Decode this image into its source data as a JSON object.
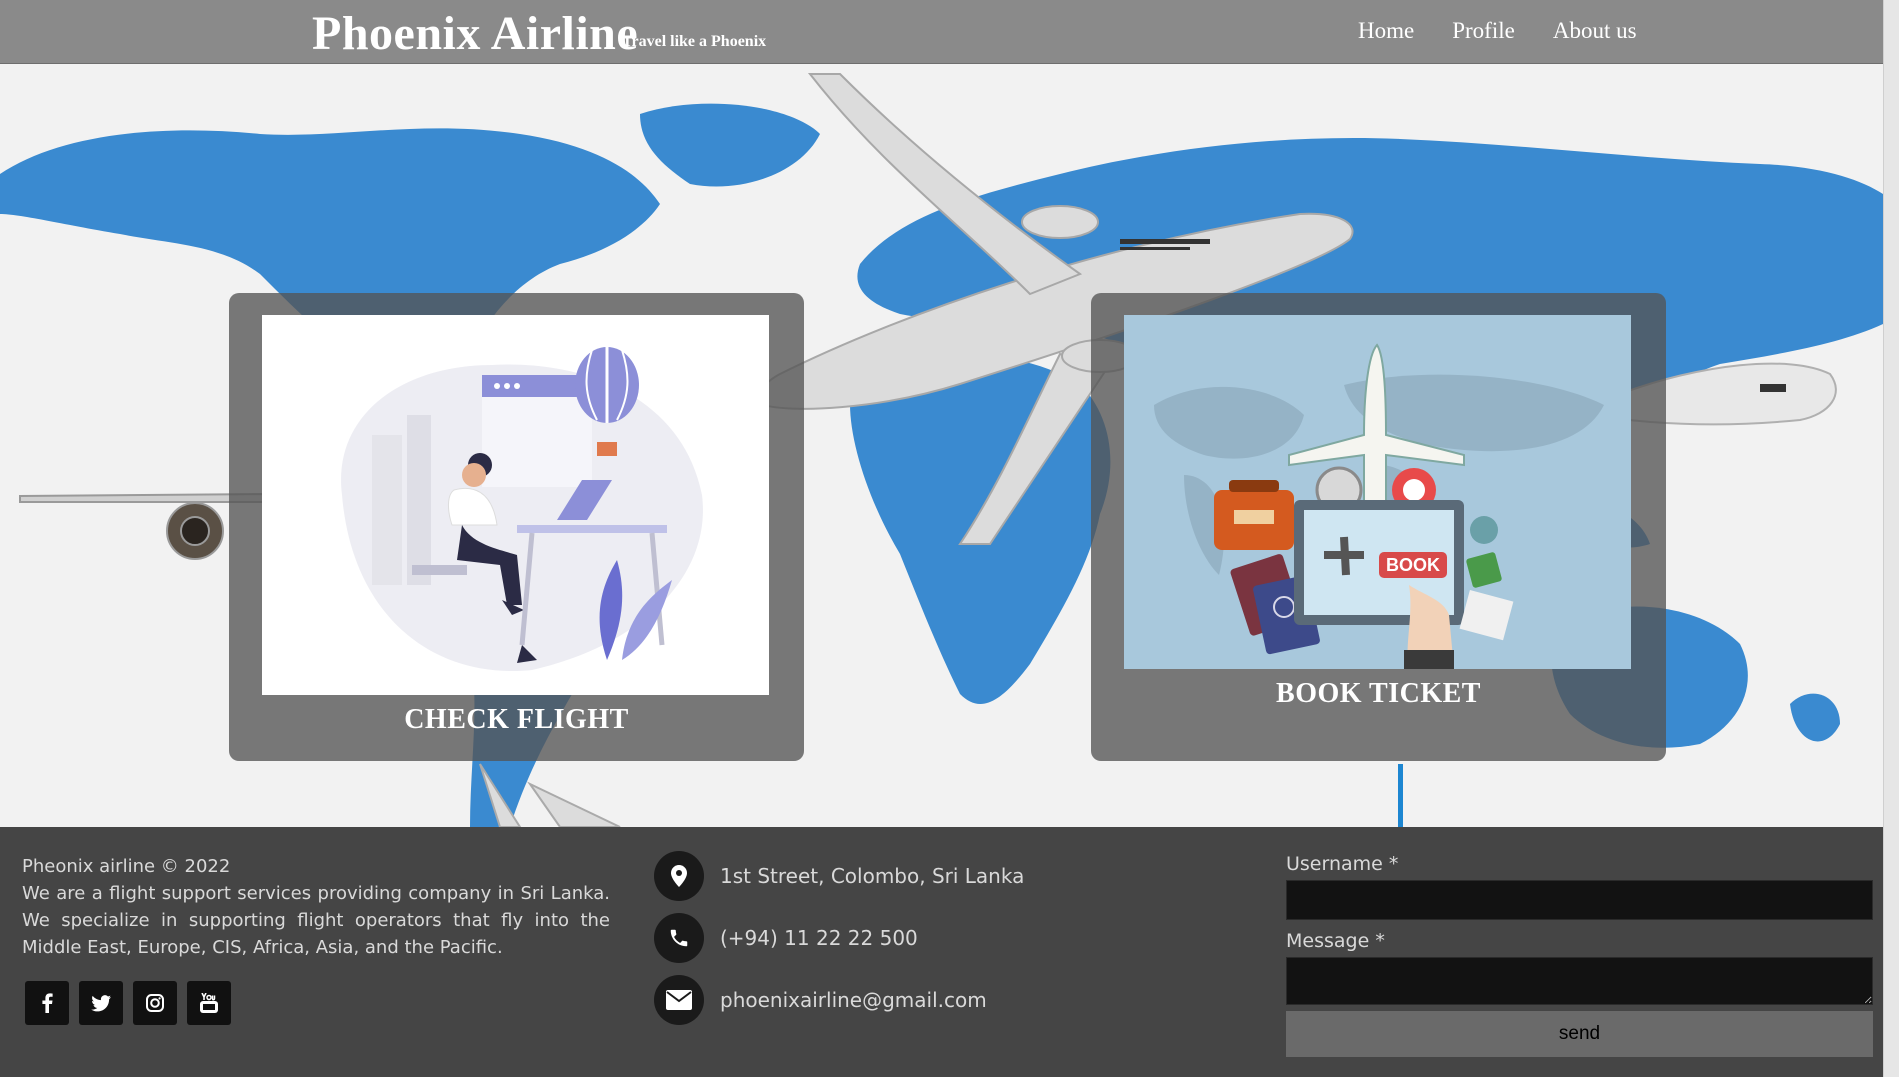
{
  "header": {
    "brand": "Phoenix Airline",
    "tagline": "Travel like a Phoenix",
    "nav": [
      {
        "label": "Home"
      },
      {
        "label": "Profile"
      },
      {
        "label": "About us"
      }
    ]
  },
  "cards": {
    "check_flight": {
      "title": "CHECK FLIGHT"
    },
    "book_ticket": {
      "title": "BOOK TICKET",
      "sign_text": "BOOK"
    }
  },
  "footer": {
    "copyright": "Pheonix airline © 2022",
    "about": "We are a flight support services providing company in Sri Lanka. We specialize in supporting flight operators that fly into the Middle East, Europe, CIS, Africa, Asia, and the Pacific.",
    "socials": [
      {
        "icon": "facebook-icon"
      },
      {
        "icon": "twitter-icon"
      },
      {
        "icon": "instagram-icon"
      },
      {
        "icon": "youtube-icon"
      }
    ],
    "contact": {
      "address": "1st Street, Colombo, Sri Lanka",
      "phone": "(+94) 11 22 22 500",
      "email": "phoenixairline@gmail.com"
    },
    "form": {
      "username_label": "Username *",
      "username_value": "",
      "message_label": "Message *",
      "message_value": "",
      "send_label": "send"
    }
  },
  "colors": {
    "header_bg": "#8a8a8a",
    "map_blue": "#3a8ad0",
    "card_overlay": "#555555",
    "footer_bg": "#454545"
  }
}
